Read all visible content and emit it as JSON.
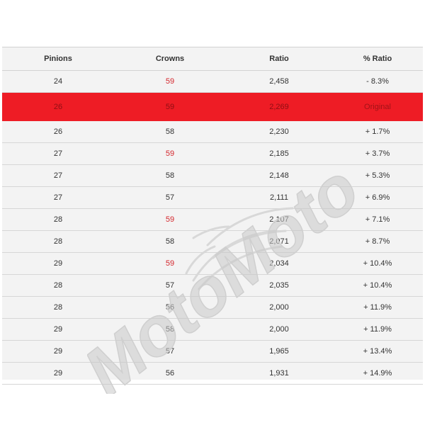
{
  "headers": {
    "pinions": "Pinions",
    "crowns": "Crowns",
    "ratio": "Ratio",
    "pct_ratio": "% Ratio"
  },
  "rows": [
    {
      "pinions": "24",
      "crowns": "59",
      "ratio": "2,458",
      "pct": "- 8.3%",
      "crowns_red": true
    },
    {
      "pinions": "26",
      "crowns": "59",
      "ratio": "2,269",
      "pct": "Original",
      "highlight": true
    },
    {
      "pinions": "26",
      "crowns": "58",
      "ratio": "2,230",
      "pct": "+ 1.7%"
    },
    {
      "pinions": "27",
      "crowns": "59",
      "ratio": "2,185",
      "pct": "+ 3.7%",
      "crowns_red": true
    },
    {
      "pinions": "27",
      "crowns": "58",
      "ratio": "2,148",
      "pct": "+ 5.3%"
    },
    {
      "pinions": "27",
      "crowns": "57",
      "ratio": "2,111",
      "pct": "+ 6.9%"
    },
    {
      "pinions": "28",
      "crowns": "59",
      "ratio": "2,107",
      "pct": "+ 7.1%",
      "crowns_red": true
    },
    {
      "pinions": "28",
      "crowns": "58",
      "ratio": "2,071",
      "pct": "+ 8.7%"
    },
    {
      "pinions": "29",
      "crowns": "59",
      "ratio": "2,034",
      "pct": "+ 10.4%",
      "crowns_red": true
    },
    {
      "pinions": "28",
      "crowns": "57",
      "ratio": "2,035",
      "pct": "+ 10.4%"
    },
    {
      "pinions": "28",
      "crowns": "56",
      "ratio": "2,000",
      "pct": "+ 11.9%"
    },
    {
      "pinions": "29",
      "crowns": "58",
      "ratio": "2,000",
      "pct": "+ 11.9%"
    },
    {
      "pinions": "29",
      "crowns": "57",
      "ratio": "1,965",
      "pct": "+ 13.4%"
    },
    {
      "pinions": "29",
      "crowns": "56",
      "ratio": "1,931",
      "pct": "+ 14.9%"
    }
  ],
  "watermark_text": "MotoMoto",
  "colors": {
    "highlight_bg": "#ee1c25",
    "red_text": "#d4272d",
    "table_bg": "#f3f3f3"
  }
}
